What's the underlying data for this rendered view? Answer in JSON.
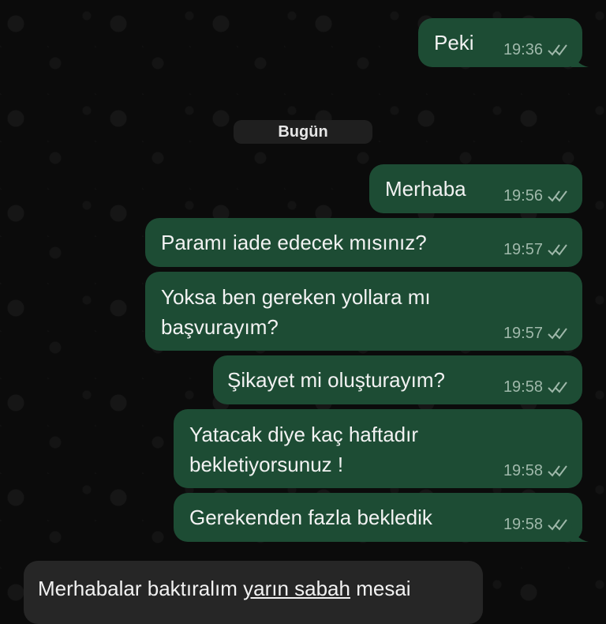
{
  "date_divider": "Bugün",
  "messages": [
    {
      "direction": "out",
      "text_lines": [
        "Peki"
      ],
      "time": "19:36",
      "status_icon": "double-check-icon"
    },
    {
      "direction": "out",
      "text_lines": [
        "Merhaba"
      ],
      "time": "19:56",
      "status_icon": "double-check-icon"
    },
    {
      "direction": "out",
      "text_lines": [
        "Paramı iade edecek mısınız?"
      ],
      "time": "19:57",
      "status_icon": "double-check-icon"
    },
    {
      "direction": "out",
      "text_lines": [
        "Yoksa ben gereken yollara mı",
        "başvurayım?"
      ],
      "time": "19:57",
      "status_icon": "double-check-icon"
    },
    {
      "direction": "out",
      "text_lines": [
        "Şikayet mi oluşturayım?"
      ],
      "time": "19:58",
      "status_icon": "double-check-icon"
    },
    {
      "direction": "out",
      "text_lines": [
        "Yatacak diye kaç haftadır",
        "bekletiyorsunuz !"
      ],
      "time": "19:58",
      "status_icon": "double-check-icon"
    },
    {
      "direction": "out",
      "text_lines": [
        "Gerekenden fazla bekledik"
      ],
      "time": "19:58",
      "status_icon": "double-check-icon"
    }
  ],
  "incoming_partial": {
    "direction": "in",
    "text_before": "Merhabalar baktıralım ",
    "text_link": "yarın sabah",
    "text_after": " mesai"
  },
  "colors": {
    "outgoing_bubble": "#1d4c34",
    "incoming_bubble": "#262626",
    "background": "#0b0b0b",
    "meta_text": "#9fb8aa"
  }
}
